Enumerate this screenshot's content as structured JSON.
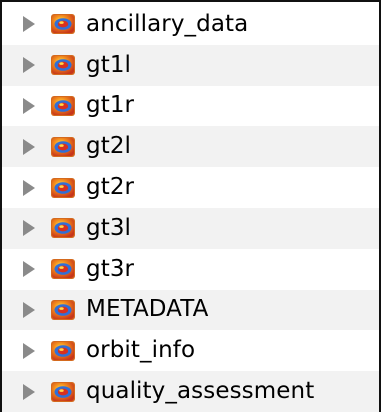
{
  "tree": {
    "items": [
      {
        "label": "ancillary_data",
        "icon": "hdf-group-icon",
        "expanded": false
      },
      {
        "label": "gt1l",
        "icon": "hdf-group-icon",
        "expanded": false
      },
      {
        "label": "gt1r",
        "icon": "hdf-group-icon",
        "expanded": false
      },
      {
        "label": "gt2l",
        "icon": "hdf-group-icon",
        "expanded": false
      },
      {
        "label": "gt2r",
        "icon": "hdf-group-icon",
        "expanded": false
      },
      {
        "label": "gt3l",
        "icon": "hdf-group-icon",
        "expanded": false
      },
      {
        "label": "gt3r",
        "icon": "hdf-group-icon",
        "expanded": false
      },
      {
        "label": "METADATA",
        "icon": "hdf-group-icon",
        "expanded": false
      },
      {
        "label": "orbit_info",
        "icon": "hdf-group-icon",
        "expanded": false
      },
      {
        "label": "quality_assessment",
        "icon": "hdf-group-icon",
        "expanded": false
      }
    ]
  },
  "colors": {
    "row_alt_background": "#f2f2f2",
    "disclosure_triangle": "#8a8a8a",
    "border": "#111111"
  }
}
